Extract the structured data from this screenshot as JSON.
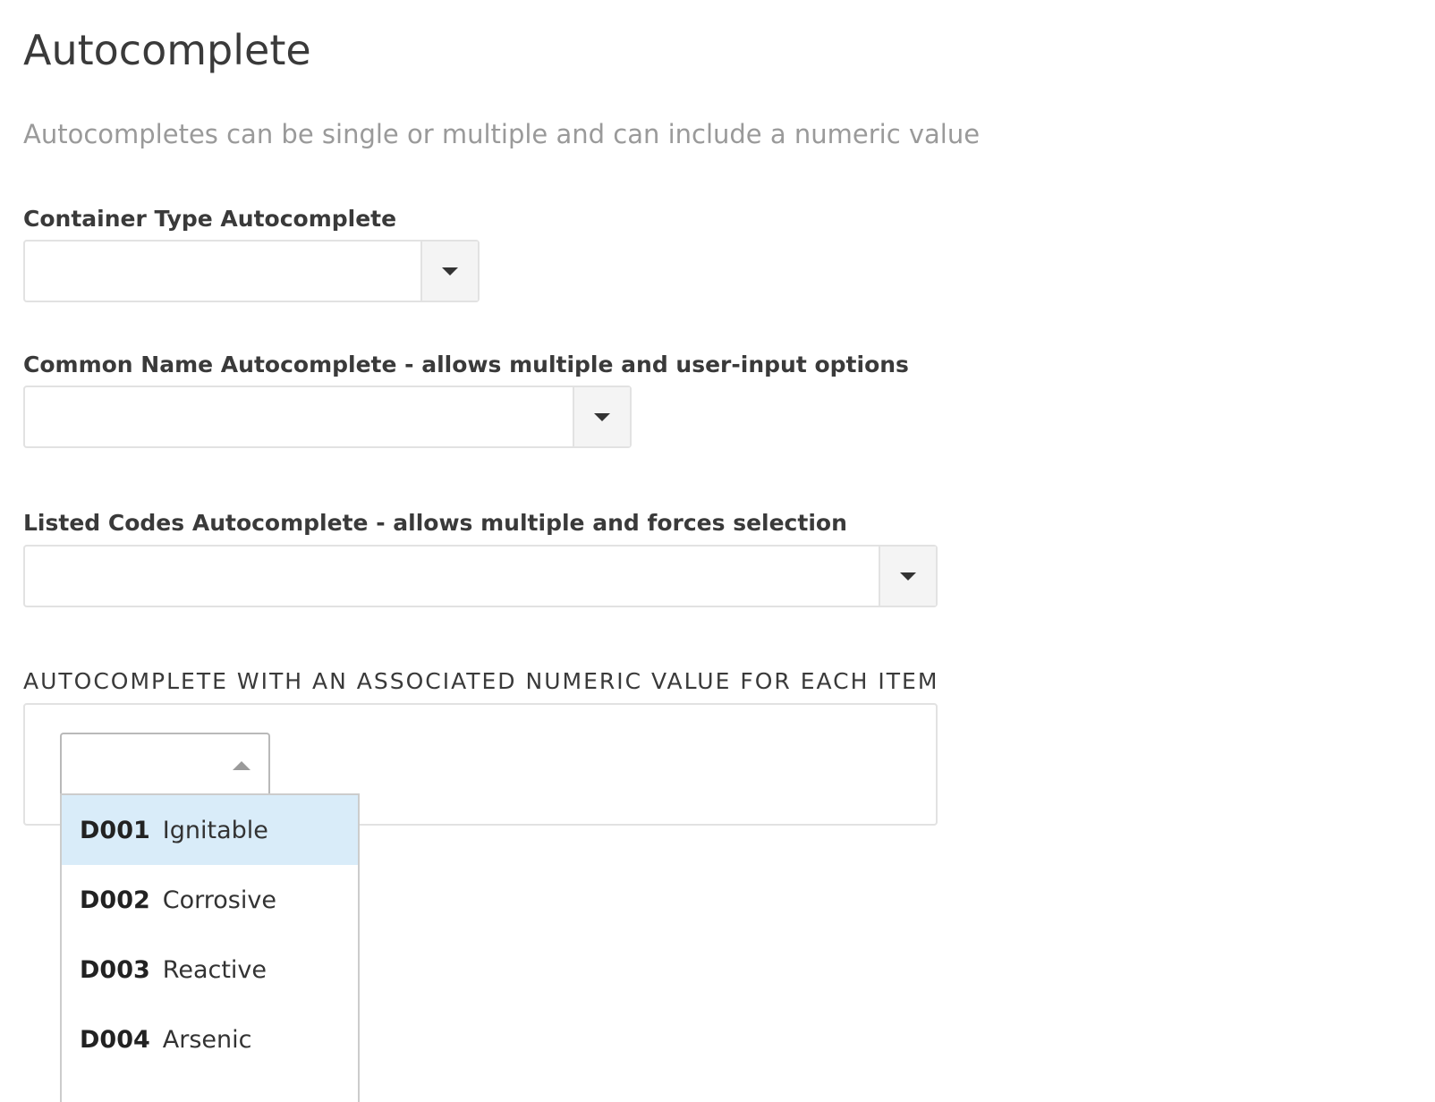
{
  "header": {
    "title": "Autocomplete",
    "subtitle": "Autocompletes can be single or multiple and can include a numeric value"
  },
  "fields": {
    "container_type": {
      "label": "Container Type Autocomplete",
      "value": ""
    },
    "common_name": {
      "label": "Common Name Autocomplete - allows multiple and user-input options",
      "value": ""
    },
    "listed_codes": {
      "label": "Listed Codes Autocomplete - allows multiple and forces selection",
      "value": ""
    }
  },
  "numeric_section": {
    "label": "AUTOCOMPLETE WITH AN ASSOCIATED NUMERIC VALUE FOR EACH ITEM",
    "select_value": "",
    "options": [
      {
        "code": "D001",
        "name": "Ignitable",
        "highlighted": true
      },
      {
        "code": "D002",
        "name": "Corrosive",
        "highlighted": false
      },
      {
        "code": "D003",
        "name": "Reactive",
        "highlighted": false
      },
      {
        "code": "D004",
        "name": "Arsenic",
        "highlighted": false
      }
    ]
  },
  "icons": {
    "dropdown_toggle": "chevron-down-icon",
    "open_select": "chevron-up-icon"
  },
  "colors": {
    "highlight": "#d9ecf9",
    "border": "#e2e2e2",
    "toggle_bg": "#f4f4f4",
    "subtitle": "#9a9a9a"
  }
}
